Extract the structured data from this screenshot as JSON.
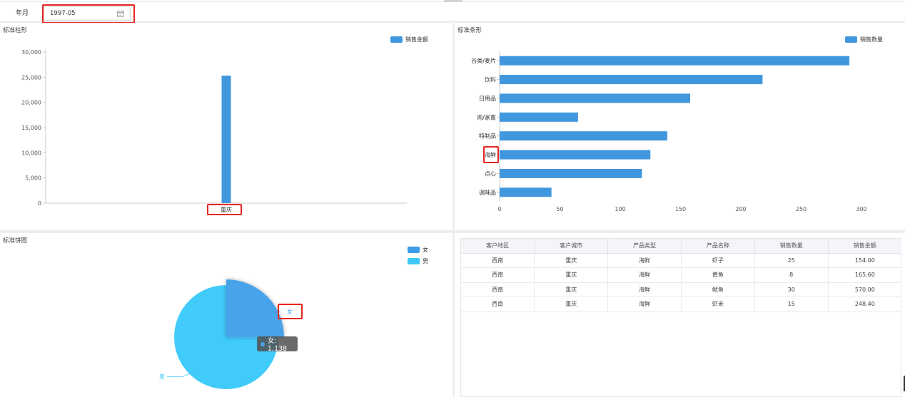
{
  "filter": {
    "label": "年月",
    "date_value": "1997-05",
    "calendar_icon": "calendar-icon"
  },
  "bar_chart": {
    "title": "标准柱形",
    "legend": "销售金额",
    "color": "#4197dd",
    "chart_data": {
      "type": "bar",
      "categories": [
        "重庆"
      ],
      "values": [
        25300
      ],
      "ylim": [
        0,
        30000
      ],
      "yticks": [
        "30,000",
        "25,000",
        "20,000",
        "15,000",
        "10,000",
        "5,000",
        "0"
      ],
      "yticks_values": [
        30000,
        25000,
        20000,
        15000,
        10000,
        5000,
        0
      ],
      "legend_placement": "top-right"
    }
  },
  "hbar_chart": {
    "title": "标准条形",
    "legend": "销售数量",
    "color": "#4197dd",
    "chart_data": {
      "type": "bar",
      "orientation": "horizontal",
      "categories": [
        "谷类/麦片",
        "饮料",
        "日用品",
        "肉/家禽",
        "特制品",
        "海鲜",
        "点心",
        "调味品"
      ],
      "values": [
        290,
        218,
        158,
        65,
        139,
        125,
        118,
        43
      ],
      "xlim": [
        0,
        300
      ],
      "xticks": [
        "0",
        "50",
        "100",
        "150",
        "200",
        "250",
        "300"
      ],
      "xticks_values": [
        0,
        50,
        100,
        150,
        200,
        250,
        300
      ],
      "legend_placement": "top-right"
    }
  },
  "pie_chart": {
    "title": "标准饼图",
    "legend": [
      {
        "label": "女",
        "color": "#3d9ce8"
      },
      {
        "label": "男",
        "color": "#3ec8f5"
      }
    ],
    "slice_labels": {
      "female": "女",
      "male": "男"
    },
    "tooltip": "女: 1,138",
    "chart_data": {
      "type": "pie",
      "labels": [
        "女",
        "男"
      ],
      "values": [
        1138,
        3400
      ],
      "colors": [
        "#4aa3ea",
        "#40cbfb"
      ]
    }
  },
  "table": {
    "headers": [
      "客户地区",
      "客户城市",
      "产品类型",
      "产品名称",
      "销售数量",
      "销售金额"
    ],
    "rows": [
      [
        "西南",
        "重庆",
        "海鲜",
        "虾子",
        "25",
        "154.00"
      ],
      [
        "西南",
        "重庆",
        "海鲜",
        "黄鱼",
        "8",
        "165.60"
      ],
      [
        "西南",
        "重庆",
        "海鲜",
        "鱿鱼",
        "30",
        "570.00"
      ],
      [
        "西南",
        "重庆",
        "海鲜",
        "虾米",
        "15",
        "248.40"
      ]
    ]
  }
}
